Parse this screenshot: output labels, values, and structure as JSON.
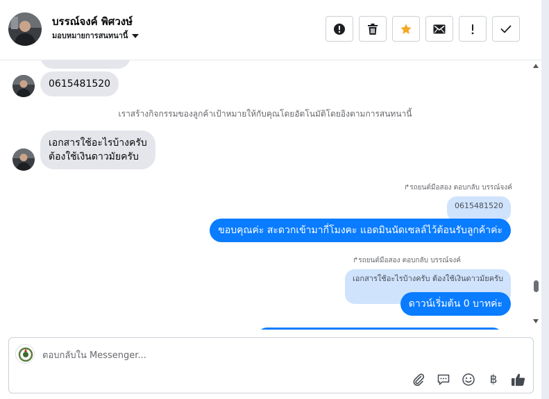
{
  "header": {
    "contact_name": "บรรณ์จงค์ พิศวงษ์",
    "assign_label": "มอบหมายการสนทนานี้",
    "actions": [
      {
        "name": "mark-spam-button",
        "icon": "exclamation-circle-icon"
      },
      {
        "name": "delete-button",
        "icon": "trash-icon"
      },
      {
        "name": "star-button",
        "icon": "star-icon",
        "color": "#f5a623"
      },
      {
        "name": "mark-unread-button",
        "icon": "envelope-icon"
      },
      {
        "name": "follow-up-button",
        "icon": "exclamation-icon"
      },
      {
        "name": "mark-done-button",
        "icon": "checkmark-icon"
      }
    ]
  },
  "thread": {
    "msg_phone": "0615481520",
    "system_note": "เราสร้างกิจกรรมของลูกค้าเป้าหมายให้กับคุณโดยอัตโนมัติโดยอิงตามการสนทนานี้",
    "msg_question_line1": "เอกสารใช้อะไรบ้างครับ",
    "msg_question_line2": "ต้องใช้เงินดาวมัยครับ",
    "reply1": {
      "meta": "รถยนต์มือสอง ตอบกลับ บรรณ์จงค์",
      "quote": "0615481520",
      "text": "ขอบคุณค่ะ สะดวกเข้ามากี่โมงคะ แอดมินนัดเซลล์ไว้ต้อนรับลูกค้าค่ะ"
    },
    "reply2": {
      "meta": "รถยนต์มือสอง ตอบกลับ บรรณ์จงค์",
      "quote": "เอกสารใช้อะไรบ้างครับ ต้องใช้เงินดาวมัยครับ",
      "text": "ดาวน์เริ่มต้น 0 บาทค่ะ"
    }
  },
  "composer": {
    "placeholder": "ตอบกลับใน Messenger...",
    "baht_symbol": "฿"
  },
  "colors": {
    "accent": "#0a7cff",
    "quote_bg": "#cfe3fd",
    "incoming_bg": "#e4e6eb",
    "star": "#f5a623"
  }
}
